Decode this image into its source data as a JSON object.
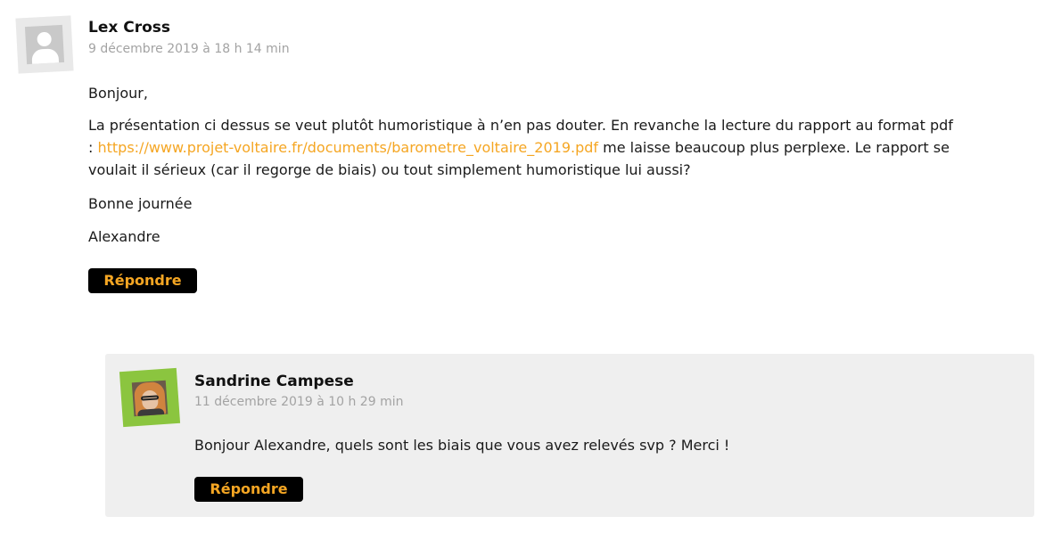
{
  "comments": [
    {
      "author": "Lex Cross",
      "date": "9 décembre 2019 à 18 h 14 min",
      "greeting": "Bonjour,",
      "body_before_link": "La présentation ci dessus se veut plutôt humoristique à n’en pas douter. En revanche la lecture du rapport au format pdf : ",
      "link_text": "https://www.projet-voltaire.fr/documents/barometre_voltaire_2019.pdf",
      "body_after_link": " me laisse beaucoup plus perplexe. Le rapport se voulait il sérieux (car il regorge de biais) ou tout simplement humoristique lui aussi?",
      "closing": "Bonne journée",
      "signature": "Alexandre",
      "reply_label": "Répondre",
      "avatar_icon": "default-user-avatar-icon"
    },
    {
      "author": "Sandrine Campese",
      "date": "11 décembre 2019 à 10 h 29 min",
      "text": "Bonjour Alexandre, quels sont les biais que vous avez relevés svp ? Merci !",
      "reply_label": "Répondre",
      "avatar_icon": "user-photo-avatar",
      "avatar_frame_color": "#8bc53f"
    }
  ],
  "colors": {
    "accent": "#f5a623",
    "button_bg": "#000000",
    "reply_bg": "#efefef",
    "date_text": "#a3a3a3"
  }
}
